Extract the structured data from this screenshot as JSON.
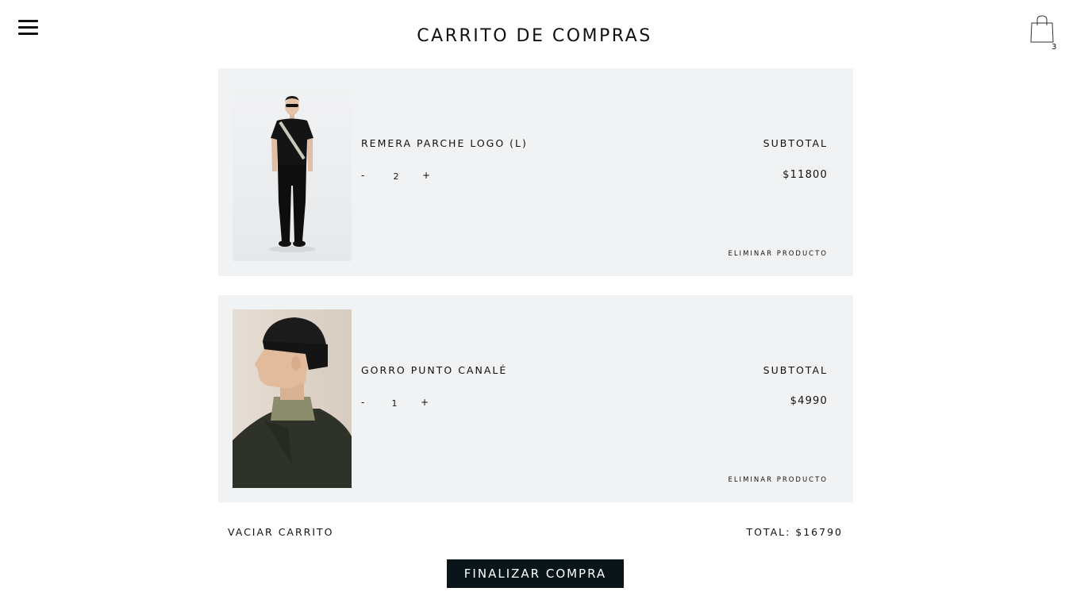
{
  "header": {
    "title": "CARRITO DE COMPRAS",
    "menu_icon": "hamburger-menu-icon",
    "cart_icon": "shopping-bag-icon",
    "cart_count": "3"
  },
  "items": [
    {
      "name": "REMERA PARCHE LOGO (L)",
      "quantity": "2",
      "minus_label": "-",
      "plus_label": "+",
      "subtotal_label": "SUBTOTAL",
      "subtotal_value": "$11800",
      "remove_label": "ELIMINAR PRODUCTO"
    },
    {
      "name": "GORRO PUNTO CANALÉ",
      "quantity": "1",
      "minus_label": "-",
      "plus_label": "+",
      "subtotal_label": "SUBTOTAL",
      "subtotal_value": "$4990",
      "remove_label": "ELIMINAR PRODUCTO"
    }
  ],
  "footer": {
    "clear_label": "VACIAR CARRITO",
    "total_label": "TOTAL: $16790",
    "checkout_label": "FINALIZAR COMPRA"
  },
  "colors": {
    "card_background": "#f1f2f3",
    "checkout_button": "#0a1519",
    "text": "#111111"
  }
}
